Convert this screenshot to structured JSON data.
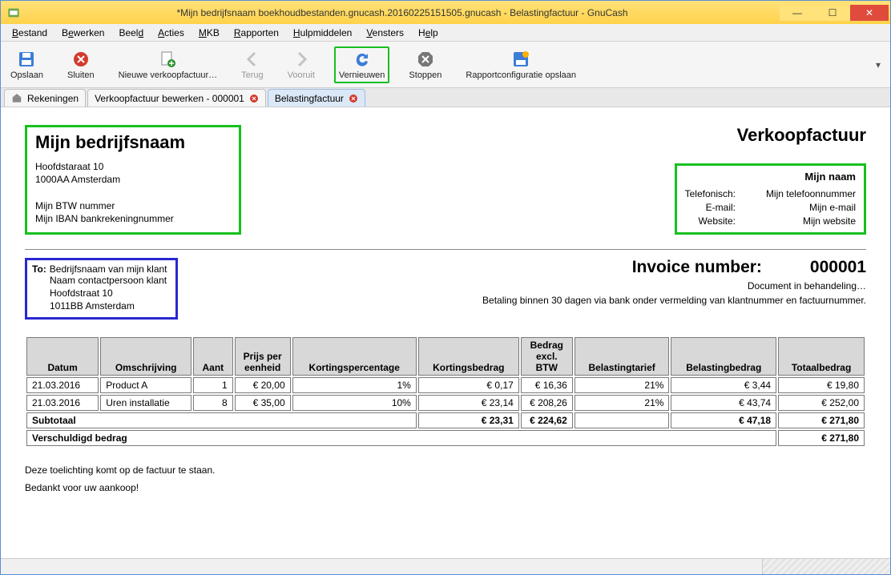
{
  "window": {
    "title": "*Mijn bedrijfsnaam boekhoudbestanden.gnucash.20160225151505.gnucash - Belastingfactuur - GnuCash"
  },
  "menu": {
    "bestand": "Bestand",
    "bewerken": "Bewerken",
    "beeld": "Beeld",
    "acties": "Acties",
    "mkb": "MKB",
    "rapporten": "Rapporten",
    "hulpmiddelen": "Hulpmiddelen",
    "vensters": "Vensters",
    "help": "Help"
  },
  "toolbar": {
    "opslaan": "Opslaan",
    "sluiten": "Sluiten",
    "nieuwe_verkoopfactuur": "Nieuwe verkoopfactuur…",
    "terug": "Terug",
    "vooruit": "Vooruit",
    "vernieuwen": "Vernieuwen",
    "stoppen": "Stoppen",
    "rapportconfig": "Rapportconfiguratie opslaan"
  },
  "tabs": {
    "rekeningen": "Rekeningen",
    "verkoopfactuur": "Verkoopfactuur bewerken - 000001",
    "belastingfactuur": "Belastingfactuur"
  },
  "invoice": {
    "company_name": "Mijn bedrijfsnaam",
    "street": "Hoofdstaraat 10",
    "postcode_city": "1000AA Amsterdam",
    "vat": "Mijn BTW nummer",
    "iban": "Mijn IBAN bankrekeningnummer",
    "type": "Verkoopfactuur",
    "contact": {
      "name": "Mijn naam",
      "phone_label": "Telefonisch:",
      "phone": "Mijn telefoonnummer",
      "email_label": "E-mail:",
      "email": "Mijn e-mail",
      "website_label": "Website:",
      "website": "Mijn website"
    },
    "to": {
      "label": "To:",
      "line1": "Bedrijfsnaam van mijn klant",
      "line2": "Naam contactpersoon klant",
      "line3": "Hoofdstraat 10",
      "line4": "1011BB Amsterdam"
    },
    "number_label": "Invoice number:",
    "number": "000001",
    "doc_status": "Document in behandeling…",
    "payment_note": "Betaling binnen 30 dagen via bank onder vermelding van klantnummer en factuurnummer.",
    "columns": {
      "datum": "Datum",
      "omschrijving": "Omschrijving",
      "aant": "Aant",
      "prijs": "Prijs per eenheid",
      "kortingsperc": "Kortingspercentage",
      "kortingsbedrag": "Kortingsbedrag",
      "bedrag_excl": "Bedrag excl. BTW",
      "belastingtarief": "Belastingtarief",
      "belastingbedrag": "Belastingbedrag",
      "totaal": "Totaalbedrag"
    },
    "rows": [
      {
        "datum": "21.03.2016",
        "omschr": "Product A",
        "aant": "1",
        "prijs": "€ 20,00",
        "kperc": "1%",
        "kbedrag": "€ 0,17",
        "bexcl": "€ 16,36",
        "btarief": "21%",
        "bbedrag": "€ 3,44",
        "totaal": "€ 19,80"
      },
      {
        "datum": "21.03.2016",
        "omschr": "Uren installatie",
        "aant": "8",
        "prijs": "€ 35,00",
        "kperc": "10%",
        "kbedrag": "€ 23,14",
        "bexcl": "€ 208,26",
        "btarief": "21%",
        "bbedrag": "€ 43,74",
        "totaal": "€ 252,00"
      }
    ],
    "subtotal": {
      "label": "Subtotaal",
      "kbedrag": "€ 23,31",
      "bexcl": "€ 224,62",
      "bbedrag": "€ 47,18",
      "totaal": "€ 271,80"
    },
    "due": {
      "label": "Verschuldigd bedrag",
      "totaal": "€ 271,80"
    },
    "footer1": "Deze toelichting komt op de factuur te staan.",
    "footer2": "Bedankt voor uw aankoop!"
  }
}
